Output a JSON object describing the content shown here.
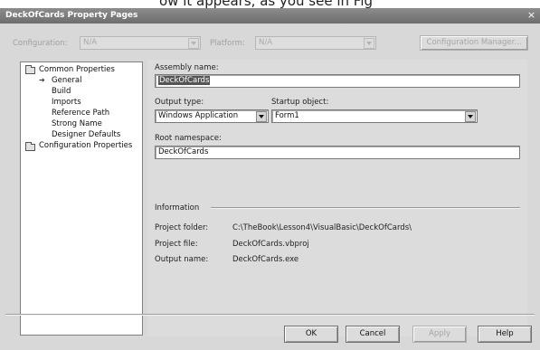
{
  "top_text": "ow it appears, as you see in Fig",
  "window": {
    "title": "DeckOfCards Property Pages",
    "close_glyph": "×"
  },
  "toolbar": {
    "configuration_label": "Configuration:",
    "configuration_value": "N/A",
    "platform_label": "Platform:",
    "platform_value": "N/A",
    "config_manager_label": "Configuration Manager..."
  },
  "tree": {
    "items": [
      {
        "label": "Common Properties"
      },
      {
        "label": "General"
      },
      {
        "label": "Build"
      },
      {
        "label": "Imports"
      },
      {
        "label": "Reference Path"
      },
      {
        "label": "Strong Name"
      },
      {
        "label": "Designer Defaults"
      },
      {
        "label": "Configuration Properties"
      }
    ]
  },
  "form": {
    "assembly_name_label": "Assembly name:",
    "assembly_name_value": "DeckOfCards",
    "output_type_label": "Output type:",
    "output_type_value": "Windows Application",
    "startup_object_label": "Startup object:",
    "startup_object_value": "Form1",
    "root_namespace_label": "Root namespace:",
    "root_namespace_value": "DeckOfCards"
  },
  "info": {
    "heading": "Information",
    "project_folder_label": "Project folder:",
    "project_folder_value": "C:\\TheBook\\Lesson4\\VisualBasic\\DeckOfCards\\",
    "project_file_label": "Project file:",
    "project_file_value": "DeckOfCards.vbproj",
    "output_name_label": "Output name:",
    "output_name_value": "DeckOfCards.exe"
  },
  "buttons": {
    "ok": "OK",
    "cancel": "Cancel",
    "apply": "Apply",
    "help": "Help"
  }
}
